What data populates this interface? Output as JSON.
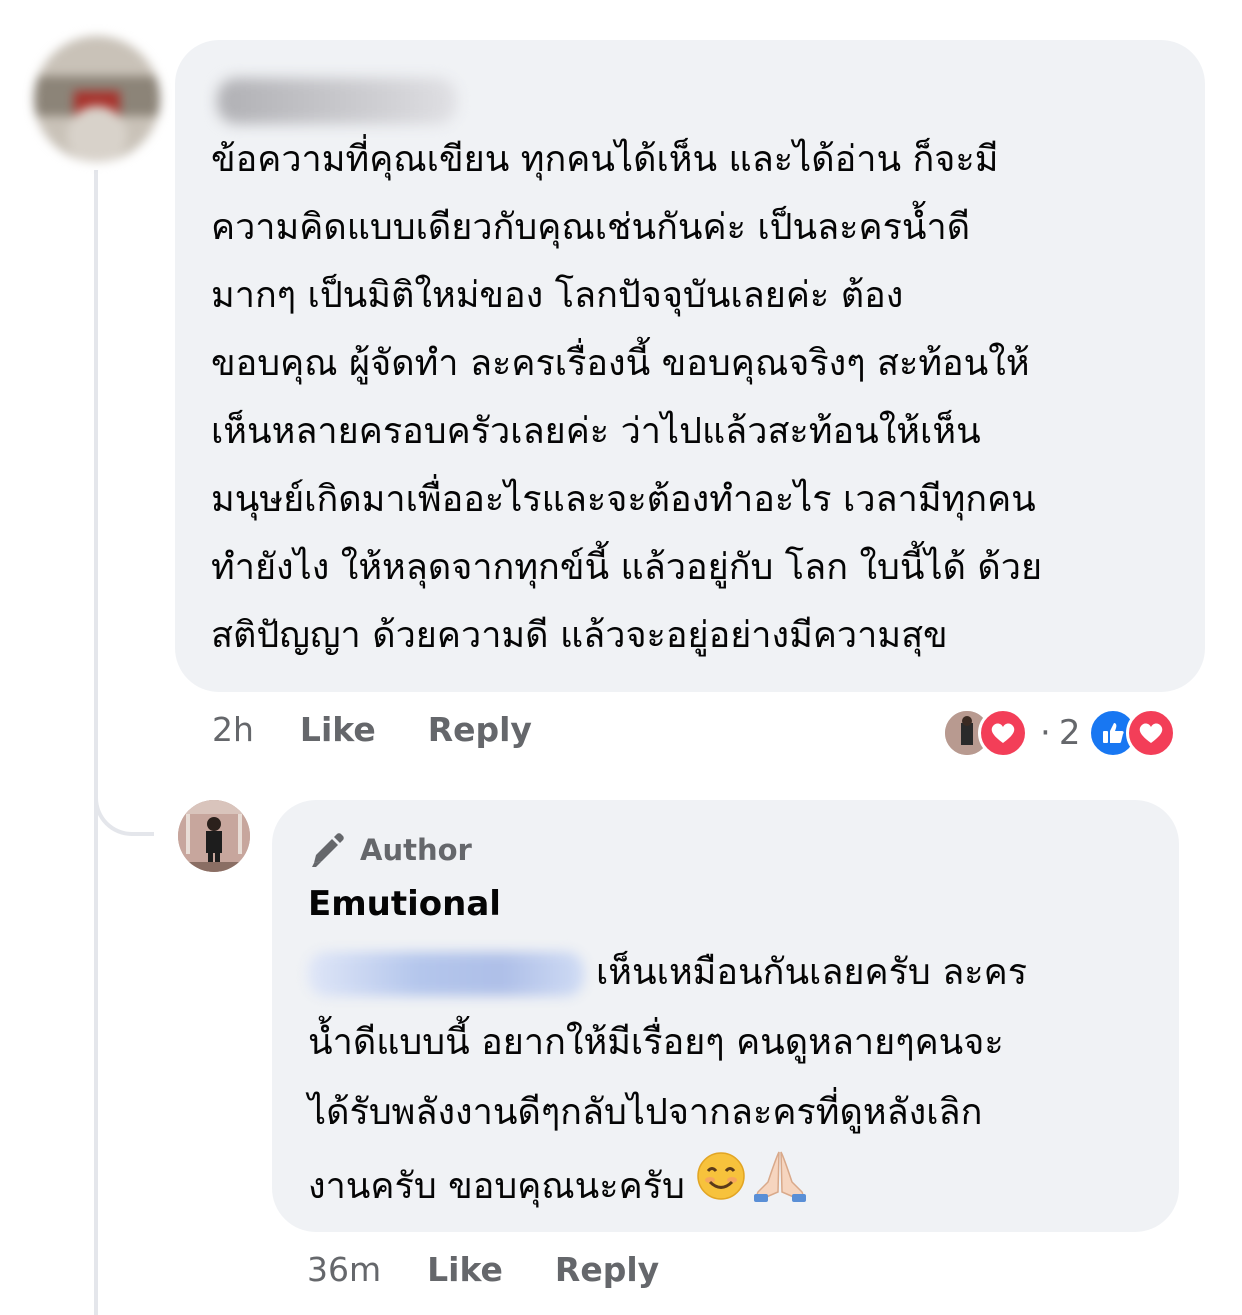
{
  "comment": {
    "text": "ข้อความที่คุณเขียน ทุกคนได้เห็น และได้อ่าน ก็จะมี\nความคิดแบบเดียวกับคุณเช่นกันค่ะ เป็นละครน้ำดี\nมากๆ เป็นมิติใหม่ของ โลกปัจจุบันเลยค่ะ ต้อง\nขอบคุณ ผู้จัดทำ ละครเรื่องนี้ ขอบคุณจริงๆ สะท้อนให้\nเห็นหลายครอบครัวเลยค่ะ ว่าไปแล้วสะท้อนให้เห็น\nมนุษย์เกิดมาเพื่ออะไรและจะต้องทำอะไร เวลามีทุกคน\nทำยังไง ให้หลุดจากทุกข์นี้ แล้วอยู่กับ โลก ใบนี้ได้ ด้วย\nสติปัญญา ด้วยความดี แล้วจะอยู่อย่างมีความสุข",
    "time": "2h",
    "like": "Like",
    "reply": "Reply",
    "reaction_count": "2",
    "reaction_separator": "·"
  },
  "reply": {
    "badge": "Author",
    "name": "Emutional",
    "line1": "เห็นเหมือนกันเลยครับ ละคร",
    "line2": "น้ำดีแบบนี้ อยากให้มีเรื่อยๆ คนดูหลายๆคนจะ",
    "line3": "ได้รับพลังงานดีๆกลับไปจากละครที่ดูหลังเลิก",
    "line4": "งานครับ  ขอบคุณนะครับ ",
    "time": "36m",
    "like": "Like",
    "reply": "Reply"
  },
  "colors": {
    "bubble": "#f0f2f5",
    "meta": "#65676b",
    "like_blue": "#1877f2",
    "heart_red": "#f33e58"
  },
  "icons": [
    "pen-icon",
    "like-reaction-icon",
    "love-reaction-icon",
    "smiling-face-emoji",
    "folded-hands-emoji"
  ]
}
